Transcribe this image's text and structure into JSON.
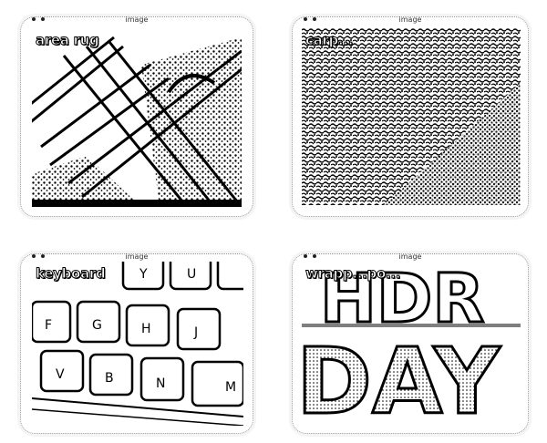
{
  "cards": [
    {
      "title": "image",
      "label": "area rug"
    },
    {
      "title": "image",
      "label": "carp..."
    },
    {
      "title": "image",
      "label": "keyboard",
      "keys": [
        "Y",
        "U",
        "F",
        "G",
        "H",
        "J",
        "V",
        "B",
        "N",
        "M"
      ]
    },
    {
      "title": "image",
      "label": "wrapp...po...",
      "poster_text": [
        "HDR",
        "DAY"
      ]
    }
  ]
}
